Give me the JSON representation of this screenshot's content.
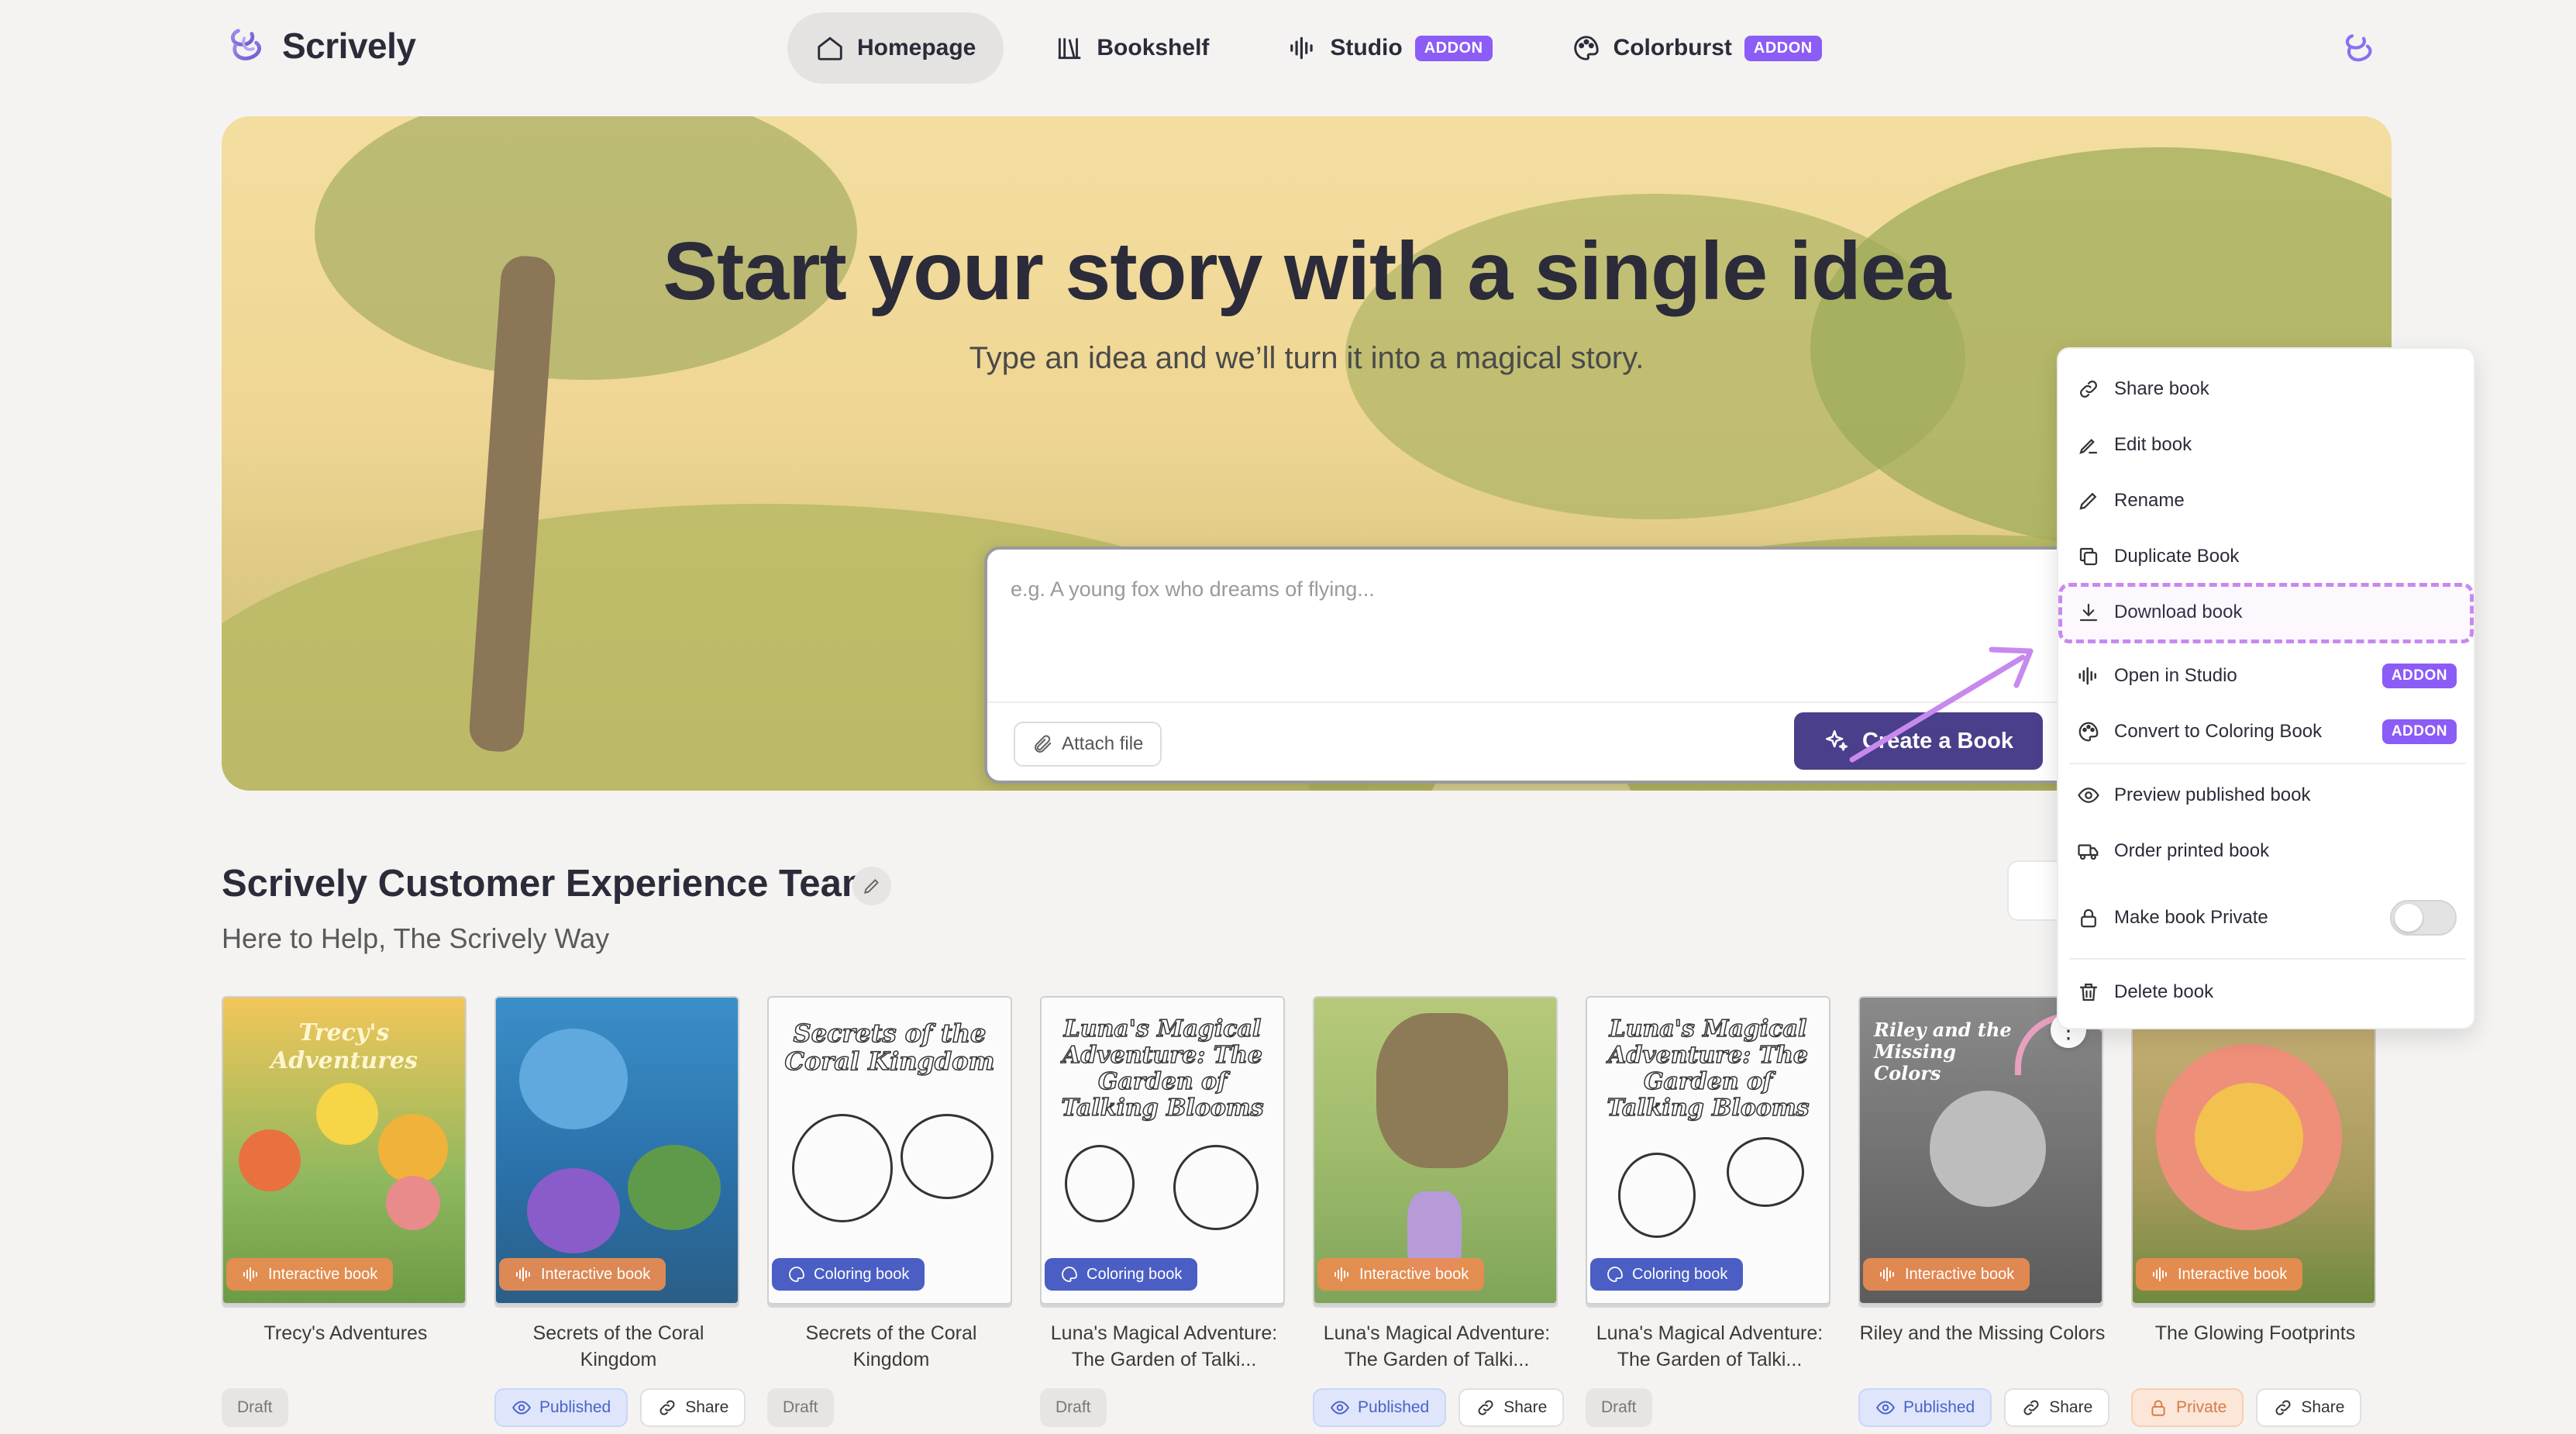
{
  "app": {
    "name": "Scrively"
  },
  "nav": {
    "tabs": [
      {
        "label": "Homepage",
        "icon": "home-icon",
        "active": true
      },
      {
        "label": "Bookshelf",
        "icon": "bookshelf-icon"
      },
      {
        "label": "Studio",
        "icon": "waveform-icon",
        "addon": "ADDON"
      },
      {
        "label": "Colorburst",
        "icon": "palette-icon",
        "addon": "ADDON"
      }
    ]
  },
  "hero": {
    "title": "Start your story with a single idea",
    "subtitle": "Type an idea and we’ll turn it into a magical story.",
    "prompt_placeholder": "e.g. A young fox who dreams of flying...",
    "attach_label": "Attach file",
    "create_label": "Create a Book"
  },
  "section": {
    "title": "Scrively Customer Experience Team",
    "subtitle": "Here to Help, The Scrively Way"
  },
  "books": [
    {
      "title": "Trecy's Adventures",
      "cover_text": "Trecy's Adventures",
      "type": "Interactive book",
      "status": "Draft",
      "share": null
    },
    {
      "title": "Secrets of the Coral Kingdom",
      "cover_text": "",
      "type": "Interactive book",
      "status": "Published",
      "share": "Share"
    },
    {
      "title": "Secrets of the Coral Kingdom",
      "cover_text": "Secrets of the Coral Kingdom",
      "type": "Coloring book",
      "status": "Draft",
      "share": null
    },
    {
      "title": "Luna's Magical Adventure: The Garden of Talki...",
      "cover_text": "Luna's Magical Adventure: The Garden of Talking Blooms",
      "type": "Coloring book",
      "status": "Draft",
      "share": null
    },
    {
      "title": "Luna's Magical Adventure: The Garden of Talki...",
      "cover_text": "",
      "type": "Interactive book",
      "status": "Published",
      "share": "Share"
    },
    {
      "title": "Luna's Magical Adventure: The Garden of Talki...",
      "cover_text": "Luna's Magical Adventure: The Garden of Talking Blooms",
      "type": "Coloring book",
      "status": "Draft",
      "share": null
    },
    {
      "title": "Riley and the Missing Colors",
      "cover_text": "Riley and the Missing Colors",
      "type": "Interactive book",
      "status": "Published",
      "share": "Share"
    },
    {
      "title": "The Glowing Footprints",
      "cover_text": "",
      "type": "Interactive book",
      "status": "Private",
      "share": "Share"
    }
  ],
  "menu": {
    "items": [
      {
        "label": "Share book",
        "icon": "link-icon"
      },
      {
        "label": "Edit book",
        "icon": "pen-tool-icon"
      },
      {
        "label": "Rename",
        "icon": "pencil-icon"
      },
      {
        "label": "Duplicate Book",
        "icon": "duplicate-icon"
      },
      {
        "label": "Download book",
        "icon": "download-icon",
        "highlighted": true
      },
      {
        "label": "Open in Studio",
        "icon": "waveform-icon",
        "addon": "ADDON"
      },
      {
        "label": "Convert to Coloring Book",
        "icon": "palette-icon",
        "addon": "ADDON"
      },
      {
        "label": "Preview published book",
        "icon": "eye-icon"
      },
      {
        "label": "Order printed book",
        "icon": "truck-icon"
      },
      {
        "label": "Make book Private",
        "icon": "lock-icon",
        "toggle": false
      },
      {
        "label": "Delete book",
        "icon": "trash-icon"
      }
    ]
  },
  "colors": {
    "accent": "#8b5cf6",
    "primary_button": "#4a3f8a",
    "highlight": "#c889ee",
    "interactive_badge": "#eb8c50",
    "coloring_badge": "#4a5ec4"
  }
}
